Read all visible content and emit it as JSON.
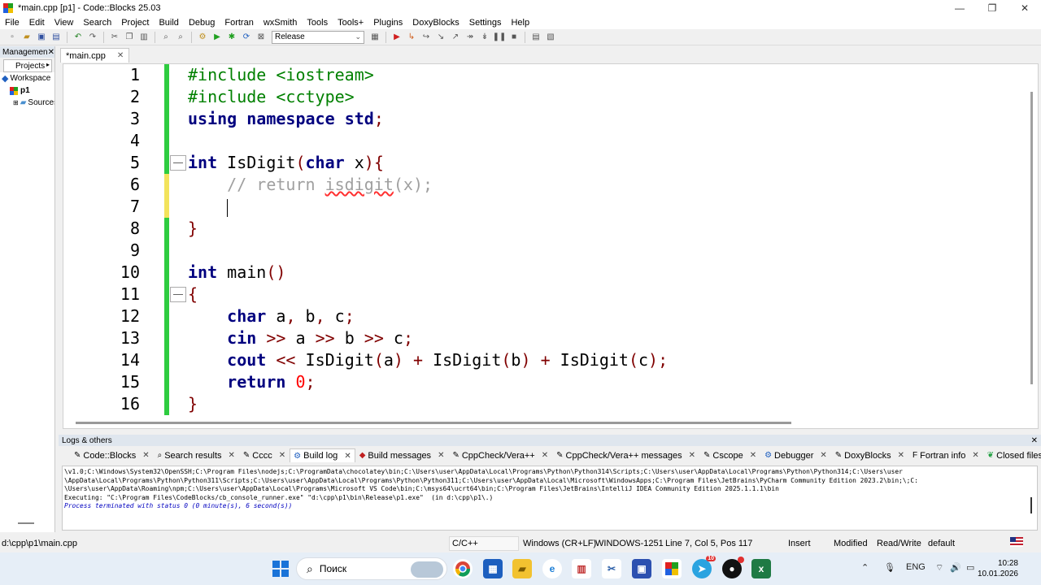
{
  "window": {
    "title": "*main.cpp [p1] - Code::Blocks 25.03",
    "minimize_glyph": "—",
    "maximize_glyph": "❐",
    "close_glyph": "✕"
  },
  "menu": [
    "File",
    "Edit",
    "View",
    "Search",
    "Project",
    "Build",
    "Debug",
    "Fortran",
    "wxSmith",
    "Tools",
    "Tools+",
    "Plugins",
    "DoxyBlocks",
    "Settings",
    "Help"
  ],
  "toolbar": {
    "build_target": "Release"
  },
  "management": {
    "title": "Managemen",
    "close": "✕",
    "tab": "Projects",
    "tree": [
      {
        "icon": "workspace-icon",
        "label": "Workspace"
      },
      {
        "icon": "project-icon",
        "label": "p1"
      },
      {
        "icon": "folder-icon",
        "label": "Sources"
      }
    ]
  },
  "editor": {
    "tab_label": "*main.cpp",
    "tab_close": "✕",
    "current_line": 7,
    "lines": [
      {
        "no": "1",
        "text": "#include <iostream>"
      },
      {
        "no": "2",
        "text": "#include <cctype>"
      },
      {
        "no": "3",
        "text": "using namespace std;"
      },
      {
        "no": "4",
        "text": ""
      },
      {
        "no": "5",
        "text": "int IsDigit(char x){"
      },
      {
        "no": "6",
        "text": "    // return isdigit(x);"
      },
      {
        "no": "7",
        "text": "    "
      },
      {
        "no": "8",
        "text": "}"
      },
      {
        "no": "9",
        "text": ""
      },
      {
        "no": "10",
        "text": "int main()"
      },
      {
        "no": "11",
        "text": "{"
      },
      {
        "no": "12",
        "text": "    char a, b, c;"
      },
      {
        "no": "13",
        "text": "    cin >> a >> b >> c;"
      },
      {
        "no": "14",
        "text": "    cout << IsDigit(a) + IsDigit(b) + IsDigit(c);"
      },
      {
        "no": "15",
        "text": "    return 0;"
      },
      {
        "no": "16",
        "text": "}"
      }
    ]
  },
  "logs": {
    "title": "Logs & others",
    "close": "✕",
    "tabs": [
      {
        "label": "Code::Blocks",
        "icon": "document-icon"
      },
      {
        "label": "Search results",
        "icon": "search-icon"
      },
      {
        "label": "Cccc",
        "icon": "document-icon"
      },
      {
        "label": "Build log",
        "icon": "gear-icon",
        "active": true
      },
      {
        "label": "Build messages",
        "icon": "build-messages-icon"
      },
      {
        "label": "CppCheck/Vera++",
        "icon": "document-icon"
      },
      {
        "label": "CppCheck/Vera++ messages",
        "icon": "document-icon"
      },
      {
        "label": "Cscope",
        "icon": "document-icon"
      },
      {
        "label": "Debugger",
        "icon": "gear-icon"
      },
      {
        "label": "DoxyBlocks",
        "icon": "document-icon"
      },
      {
        "label": "Fortran info",
        "icon": "fortran-icon"
      },
      {
        "label": "Closed files list",
        "icon": "leaf-icon"
      }
    ],
    "lines": [
      "\\v1.0;C:\\Windows\\System32\\OpenSSH;C:\\Program Files\\nodejs;C:\\ProgramData\\chocolatey\\bin;C:\\Users\\user\\AppData\\Local\\Programs\\Python\\Python314\\Scripts;C:\\Users\\user\\AppData\\Local\\Programs\\Python\\Python314;C:\\Users\\user",
      "\\AppData\\Local\\Programs\\Python\\Python311\\Scripts;C:\\Users\\user\\AppData\\Local\\Programs\\Python\\Python311;C:\\Users\\user\\AppData\\Local\\Microsoft\\WindowsApps;C:\\Program Files\\JetBrains\\PyCharm Community Edition 2023.2\\bin;\\;C:",
      "\\Users\\user\\AppData\\Roaming\\npm;C:\\Users\\user\\AppData\\Local\\Programs\\Microsoft VS Code\\bin;C:\\msys64\\ucrt64\\bin;C:\\Program Files\\JetBrains\\IntelliJ IDEA Community Edition 2025.1.1.1\\bin",
      "Executing: \"C:\\Program Files\\CodeBlocks/cb_console_runner.exe\" \"d:\\cpp\\p1\\bin\\Release\\p1.exe\"  (in d:\\cpp\\p1\\.)"
    ],
    "final_line": "Process terminated with status 0 (0 minute(s), 6 second(s))"
  },
  "statusbar": {
    "path": "d:\\cpp\\p1\\main.cpp",
    "language": "C/C++",
    "eol": "Windows (CR+LF)",
    "encoding": "WINDOWS-1251",
    "position": "Line 7, Col 5, Pos 117",
    "mode": "Insert",
    "modified": "Modified",
    "access": "Read/Write",
    "profile": "default"
  },
  "taskbar": {
    "search_placeholder": "Поиск",
    "language": "ENG",
    "time": "10:28",
    "date": "10.01.2026",
    "telegram_badge": "10"
  }
}
